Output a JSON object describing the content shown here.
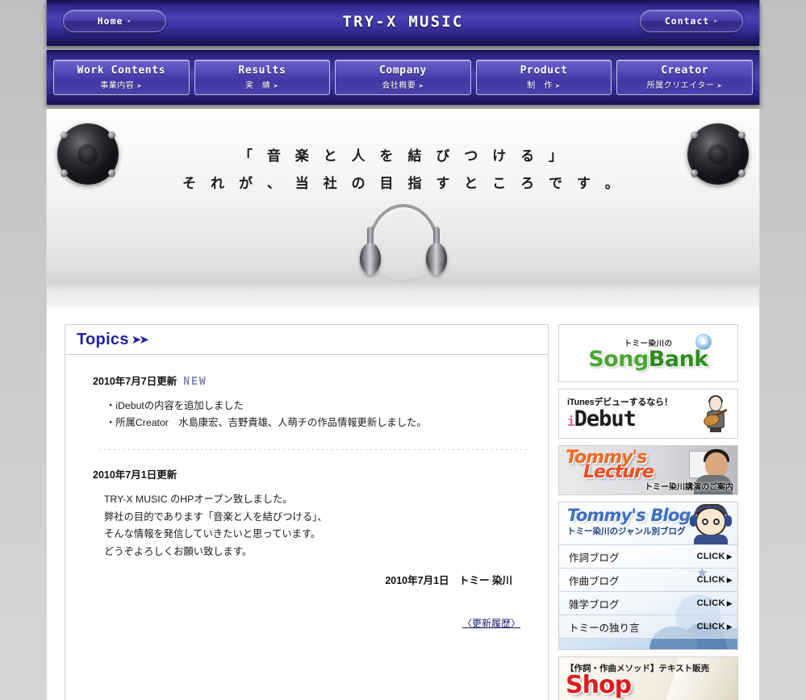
{
  "header": {
    "site_title": "TRY-X MUSIC",
    "home_label": "Home",
    "contact_label": "Contact",
    "arrow": "➤"
  },
  "nav": {
    "items": [
      {
        "en": "Work Contents",
        "jp": "事業内容"
      },
      {
        "en": "Results",
        "jp": "実　績"
      },
      {
        "en": "Company",
        "jp": "会社概要"
      },
      {
        "en": "Product",
        "jp": "制　作"
      },
      {
        "en": "Creator",
        "jp": "所属クリエイター"
      }
    ],
    "arrow": "➤"
  },
  "hero": {
    "line1": "「 音 楽 と 人 を 結 び つ け る 」",
    "line2": "そ れ が 、 当 社 の 目 指 す と こ ろ で す 。"
  },
  "topics": {
    "title": "Topics",
    "arrows": "➤➤",
    "entries": [
      {
        "date": "2010年7月7日更新",
        "badge": "NEW",
        "items": [
          "・iDebutの内容を追加しました",
          "・所属Creator　水島康宏、吉野貴雄、人萌チの作品情報更新しました。"
        ]
      },
      {
        "date": "2010年7月1日更新",
        "badge": "",
        "items": [
          "TRY-X MUSIC のHPオープン致しました。",
          "弊社の目的であります「音楽と人を結びつける」、",
          "そんな情報を発信していきたいと思っています。",
          "どうぞよろしくお願い致します。"
        ],
        "signature": "2010年7月1日　トミー 染川"
      }
    ],
    "history_link": "〈更新履歴〉"
  },
  "sidebar": {
    "songbank": {
      "pre": "トミー染川の",
      "main_1": "Song",
      "main_2": "Bank"
    },
    "idebut": {
      "top": "iTunesデビューするなら！",
      "main_pre": "i",
      "main": "Debut"
    },
    "lecture": {
      "line1": "Tommy's",
      "line2": "Lecture",
      "sub": "トミー染川講演のご案内"
    },
    "blog": {
      "title": "Tommy's Blog",
      "subtitle": "トミー染川のジャンル別ブログ",
      "rows": [
        {
          "label": "作詞ブログ",
          "click": "CLICK",
          "tri": "▶"
        },
        {
          "label": "作曲ブログ",
          "click": "CLICK",
          "tri": "▶"
        },
        {
          "label": "雑学ブログ",
          "click": "CLICK",
          "tri": "▶"
        },
        {
          "label": "トミーの独り言",
          "click": "CLICK",
          "tri": "▶"
        }
      ]
    },
    "shop": {
      "top": "【作詞・作曲メソッド】テキスト販売",
      "main": "Shop"
    }
  },
  "colors": {
    "header_navy": "#2b2484",
    "nav_blue": "#4840b0",
    "topics_navy": "#23239c",
    "link_navy": "#1a1a6e",
    "shop_red": "#d82020",
    "song_green": "#4aa832",
    "lecture_orange": "#f04e23",
    "blog_blue": "#3f6fc0"
  }
}
